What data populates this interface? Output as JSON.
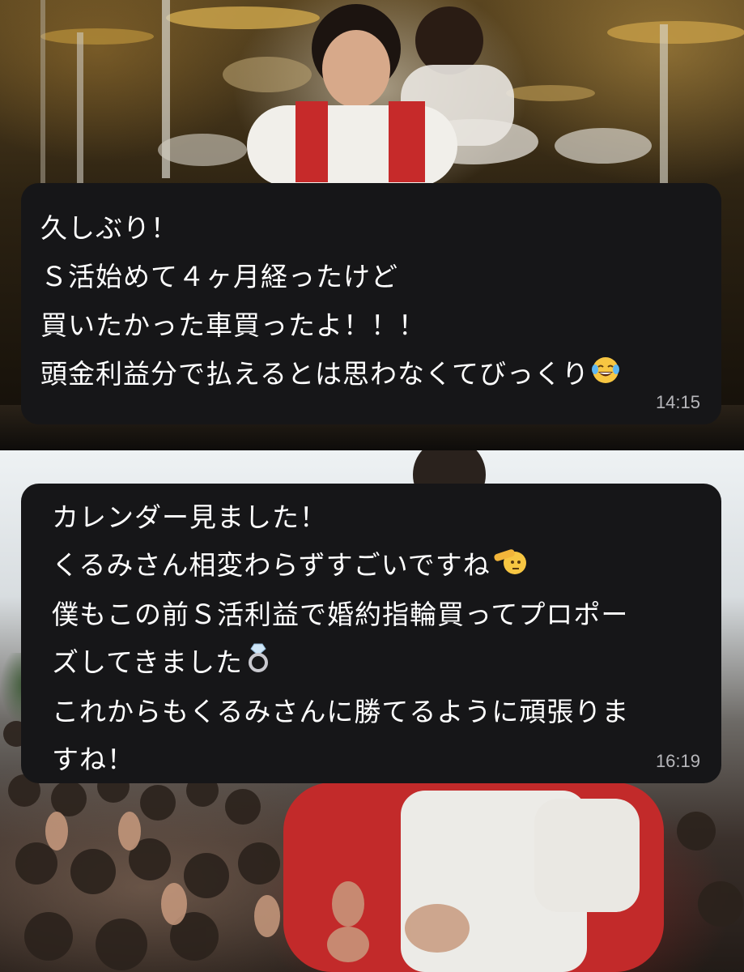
{
  "messages": [
    {
      "lines": [
        "久しぶり！",
        "Ｓ活始めて４ヶ月経ったけど",
        "買いたかった車買ったよ！！！",
        "頭金利益分で払えるとは思わなくてびっくり"
      ],
      "emojis": [
        "face-with-tears-of-joy-icon"
      ],
      "time": "14:15"
    },
    {
      "lines": [
        "カレンダー見ました！",
        "くるみさん相変わらずすごいですね",
        "僕もこの前Ｓ活利益で婚約指輪買ってプロポー",
        "ズしてきました",
        "これからもくるみさんに勝てるように頑張りま",
        "すね！"
      ],
      "emojis": [
        "saluting-face-icon",
        "ring-icon"
      ],
      "time": "16:19"
    }
  ],
  "colors": {
    "bubble_bg": "#161618",
    "text": "#ffffff",
    "timestamp": "#b7b7bb"
  }
}
